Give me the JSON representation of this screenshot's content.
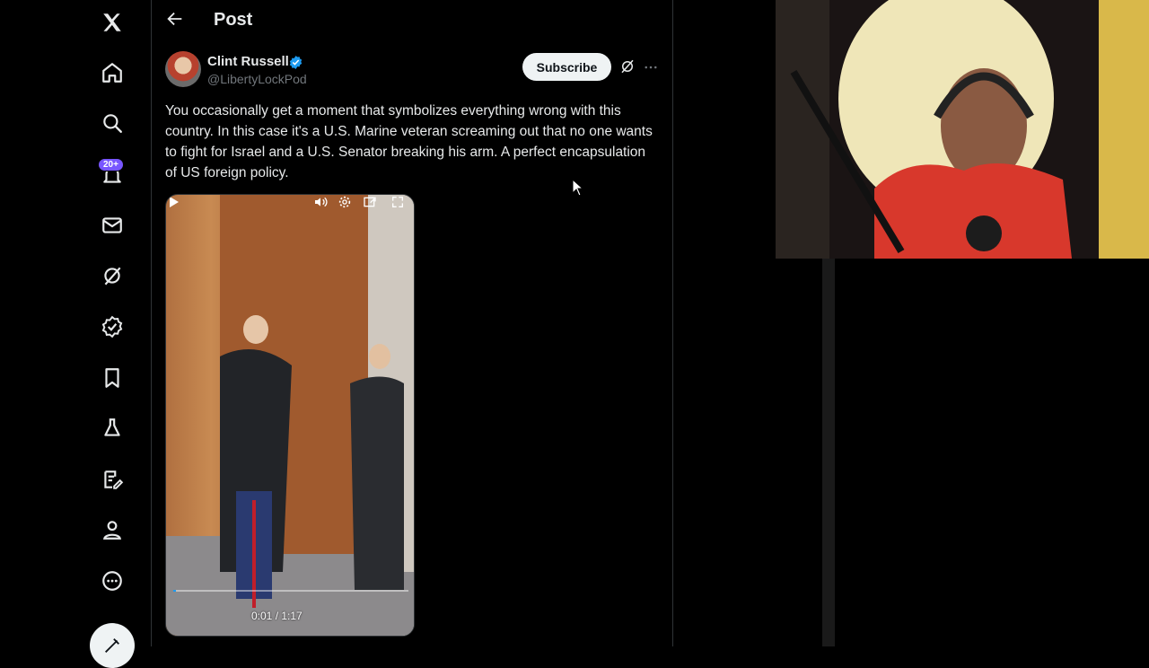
{
  "nav": {
    "items": [
      "x-logo",
      "home",
      "search",
      "notifications",
      "messages",
      "grok",
      "verified",
      "bookmarks",
      "communities",
      "premium",
      "profile",
      "more"
    ],
    "notification_badge": "20+"
  },
  "header": {
    "title": "Post"
  },
  "post": {
    "author_name": "Clint Russell",
    "author_handle": "@LibertyLockPod",
    "subscribe_label": "Subscribe",
    "text": "You occasionally get a moment that symbolizes everything wrong with this country. In this case it's a U.S. Marine veteran screaming out that no one wants to fight for Israel and a U.S. Senator breaking his arm. A perfect encapsulation of US foreign policy."
  },
  "video": {
    "time": "0:01 / 1:17",
    "progress": 0.013
  },
  "colors": {
    "background": "#000000",
    "text": "#e7e9ea",
    "muted": "#71767b",
    "verified": "#1d9bf0",
    "badge": "#7856ff"
  }
}
